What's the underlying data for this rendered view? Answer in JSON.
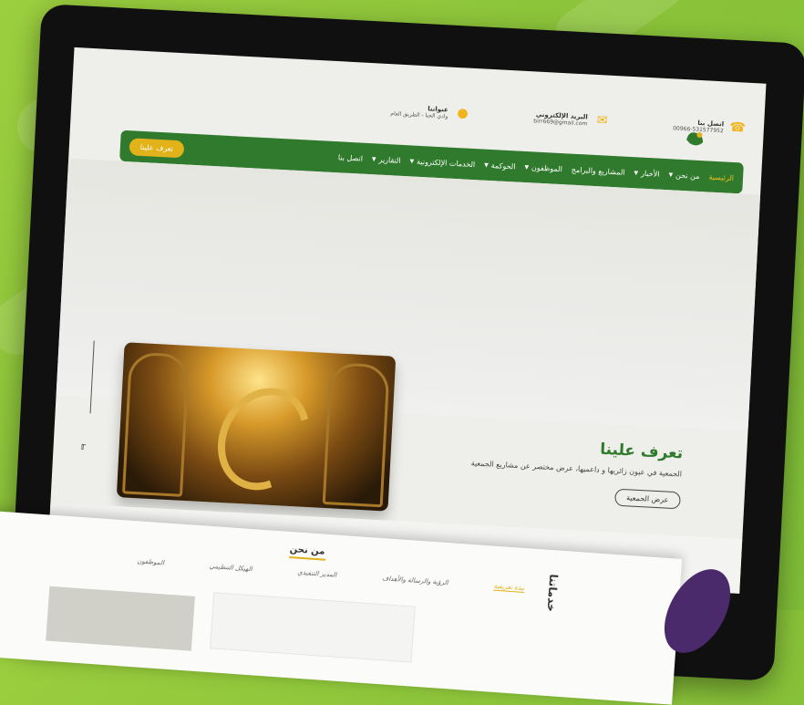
{
  "header": {
    "address_title": "عنواننا",
    "address_value": "وادي الحيا - الطريق العام",
    "email_title": "البريد الإلكتروني",
    "email_value": "birr669@gmail.com",
    "phone_title": "اتصل بنا",
    "phone_value": "00966-531577952"
  },
  "nav": {
    "items": [
      {
        "label": "الرئيسية",
        "dropdown": false,
        "active": true
      },
      {
        "label": "من نحن",
        "dropdown": true
      },
      {
        "label": "الأخبار",
        "dropdown": true
      },
      {
        "label": "المشاريع والبرامج",
        "dropdown": false
      },
      {
        "label": "الموظفون",
        "dropdown": true
      },
      {
        "label": "الحوكمة",
        "dropdown": true
      },
      {
        "label": "الخدمات الإلكترونية",
        "dropdown": true
      },
      {
        "label": "التقارير",
        "dropdown": true
      },
      {
        "label": "اتصل بنا",
        "dropdown": false
      }
    ],
    "cta": "تعرف علينا"
  },
  "about": {
    "title": "تعرف علينا",
    "description": "الجمعية في عيون زائريها و داعميها، عرض مختصر عن مشاريع الجمعية",
    "button": "عرض الجمعية"
  },
  "paper": {
    "title": "من نحن",
    "tabs": [
      "نبذة تعريفية",
      "الرؤية والرسالة والأهداف",
      "المدير التنفيذي",
      "الهيكل التنظيمي",
      "الموظفون"
    ],
    "side_label": "خدماتنا"
  },
  "colors": {
    "primary": "#2f7a2c",
    "accent": "#e2b21a"
  }
}
